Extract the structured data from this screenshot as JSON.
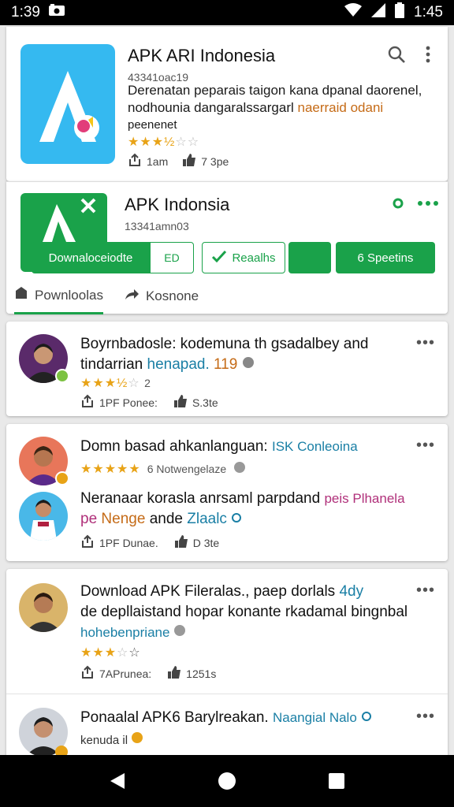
{
  "status": {
    "time_left": "1:39",
    "time_right": "1:45"
  },
  "app": {
    "title": "APK ARI Indonesia",
    "sub": "43341oac19",
    "desc_line1": "Derenatan peparais taigon kana dpanal daorenel,",
    "desc_line2a": "nodhounia dangaralssargarl",
    "desc_line2b": "naerraid odani",
    "desc_line3": "peenenet",
    "rating": 3.5,
    "meta_likes": "1am",
    "meta_other": "7 3pe"
  },
  "app2": {
    "title": "APK Indonsia",
    "sub": "13341amn03",
    "btn_download": "Downaloceiodte",
    "btn_outline": "ED",
    "btn_reaction": "Reaalhs",
    "btn_more": "6 Speetins",
    "tab1": "Pownloolas",
    "tab2": "Kosnone"
  },
  "reviews": [
    {
      "line1": "Boyrnbadosle: kodemuna th gsadalbey and",
      "line2a": "tindarrian ",
      "line2b": "henapad.",
      "line2c": " 119",
      "stars": 3.5,
      "count": "2",
      "meta1": "1PF Ponee:",
      "meta2": "S.3te"
    },
    {
      "line1a": "Domn basad ahkanlanguan: ",
      "line1b": "ISK Conleoina",
      "line2": "6 Notwengelaze",
      "stars": 5,
      "line3a": "Neranaar korasla anrsaml parpdand ",
      "line3b": "peis Plhanela",
      "line4a": "pe",
      "line4b": "Nenge",
      "line4c": " ande ",
      "line4d": "Zlaalc",
      "meta1": "1PF Dunae.",
      "meta2": "D 3te"
    },
    {
      "line1a": "Download APK Fileralas., paep dorlals ",
      "line1b": "4dy",
      "line2": "de depllaistand hopar konante rkadamal bingnbal",
      "line3": "hohebenpriane",
      "stars": 3.5,
      "meta1": "7APrunea:",
      "meta2": "1251s"
    },
    {
      "line1a": "Ponaalal APK6 Barylreakan. ",
      "line1b": "Naangial Nalo",
      "line2": "kenuda il"
    }
  ]
}
